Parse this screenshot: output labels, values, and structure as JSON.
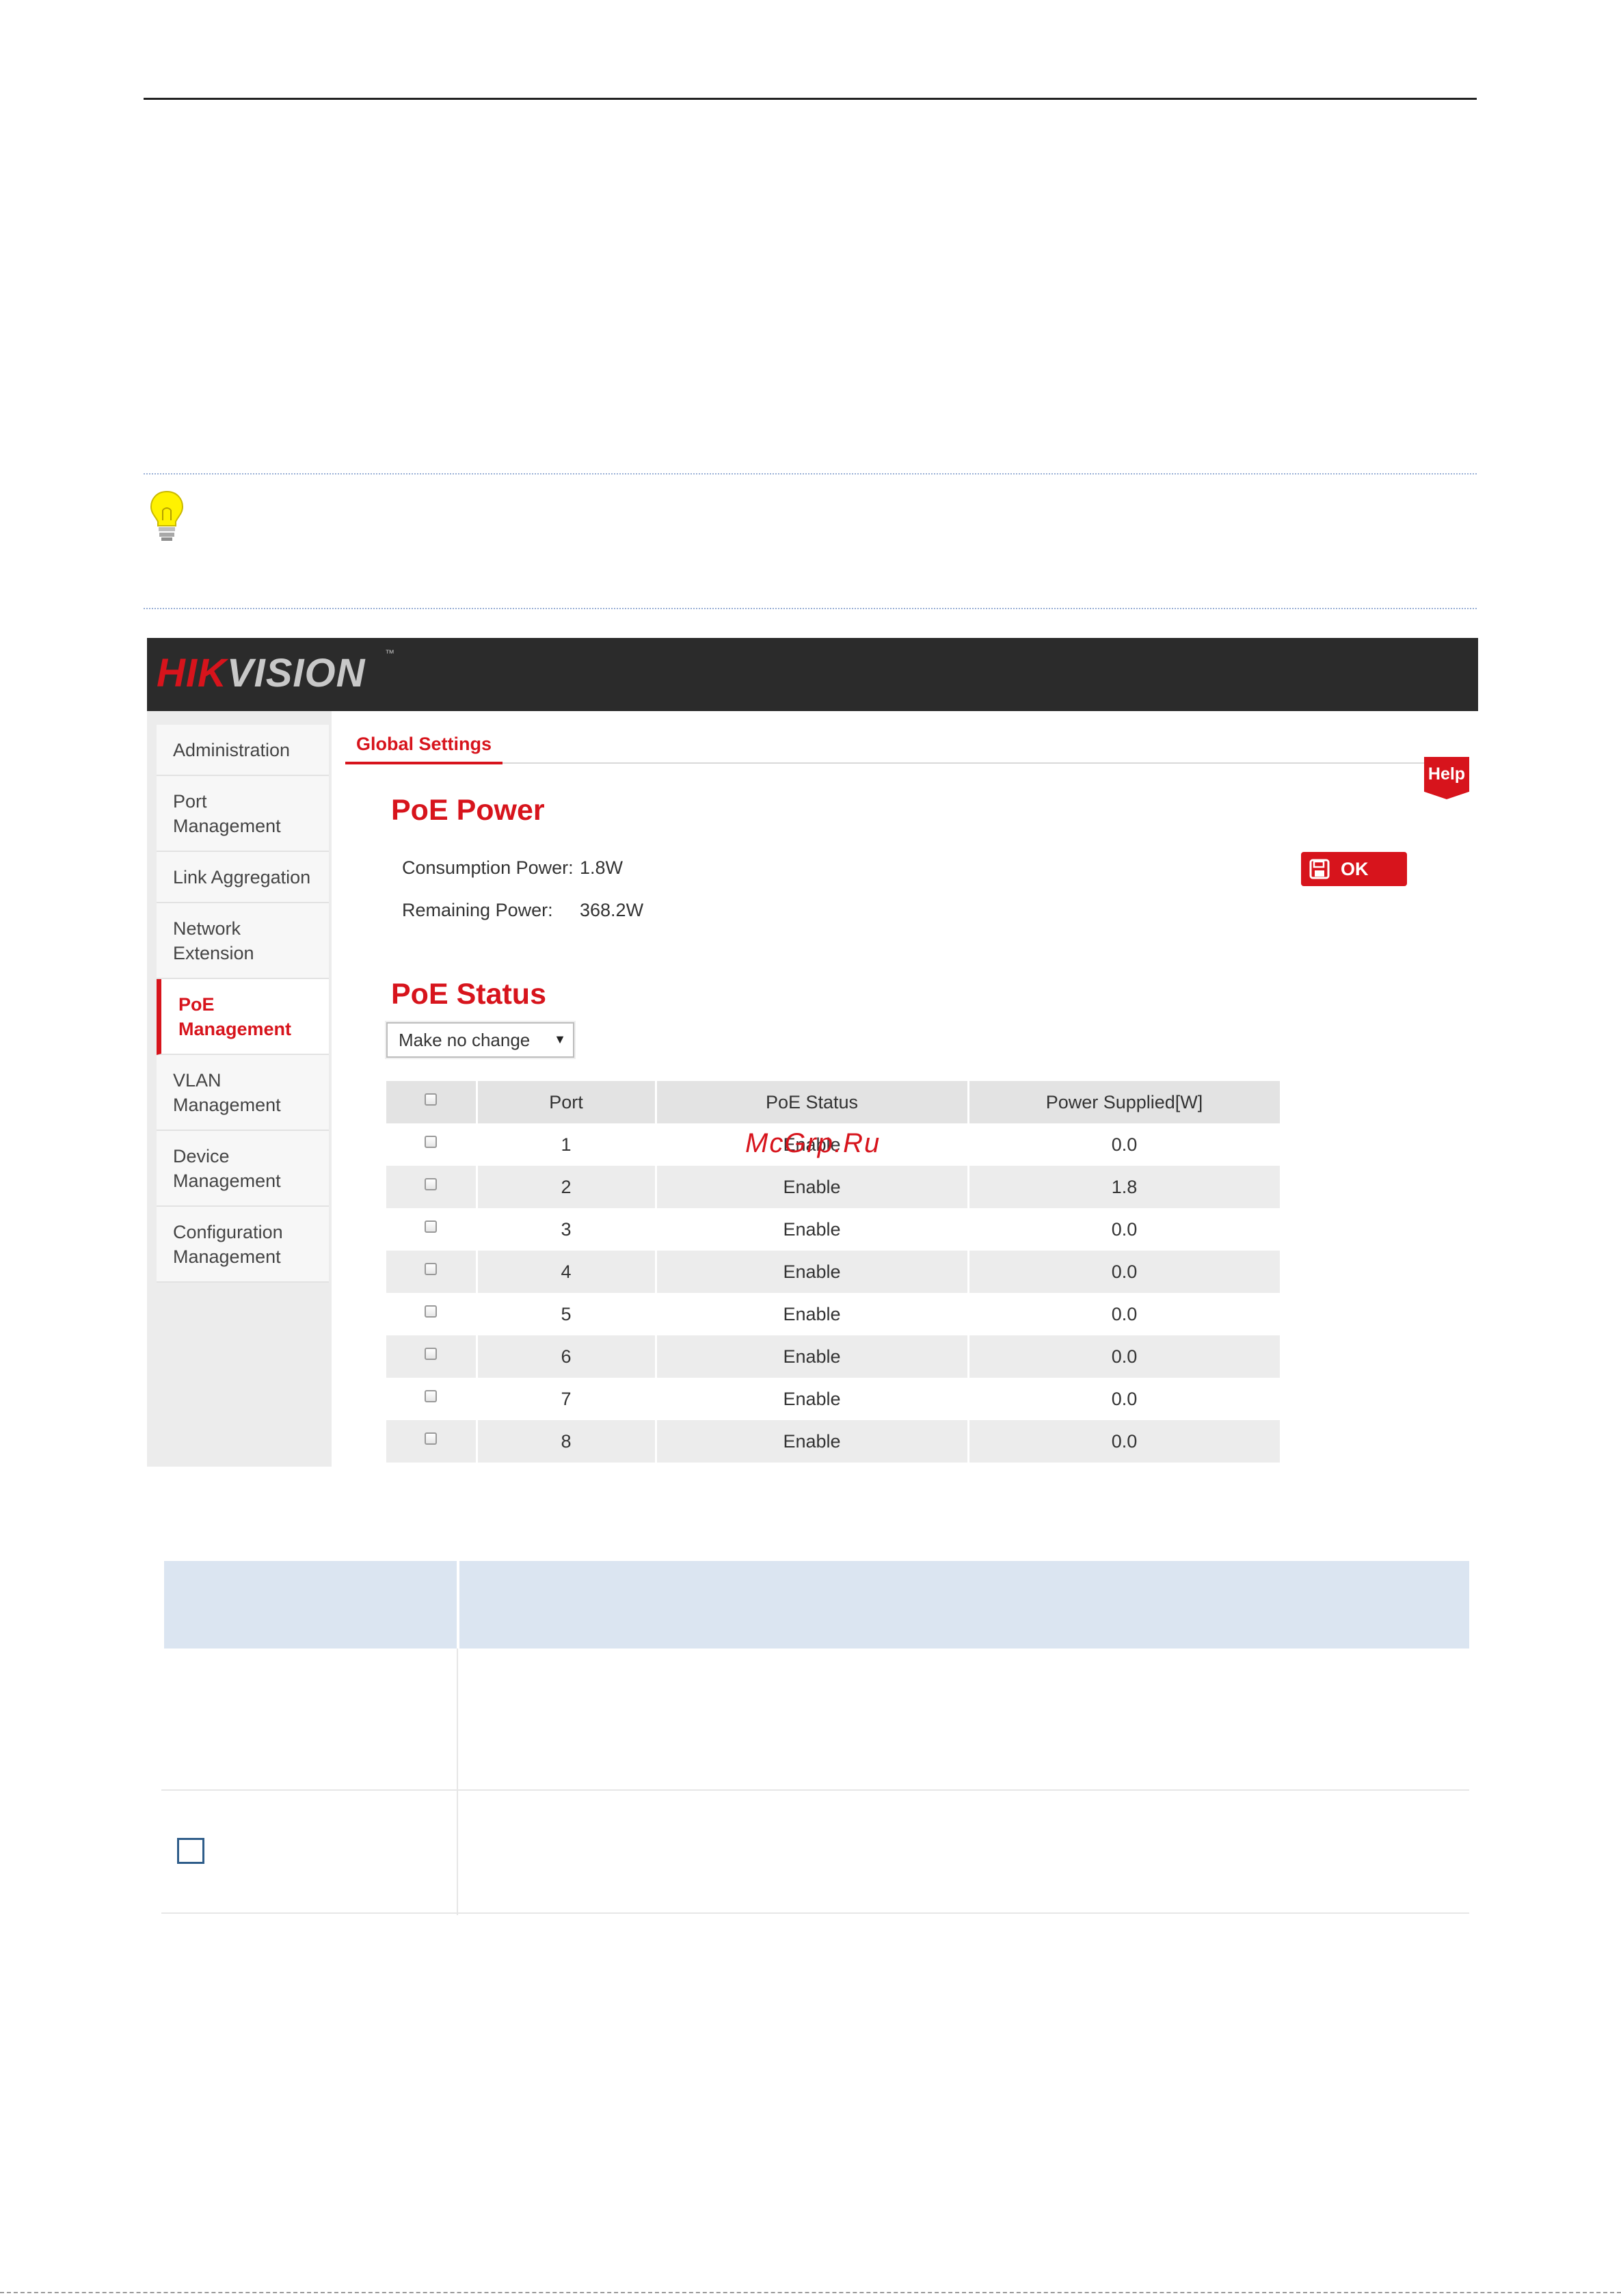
{
  "app": {
    "brand_hik": "HIK",
    "brand_vision": "VISION",
    "brand_tm": "™"
  },
  "sidebar": {
    "items": [
      {
        "label": "Administration"
      },
      {
        "label": "Port\nManagement"
      },
      {
        "label": "Link Aggregation"
      },
      {
        "label": "Network\nExtension"
      },
      {
        "label": "PoE\nManagement",
        "active": true
      },
      {
        "label": "VLAN\nManagement"
      },
      {
        "label": "Device\nManagement"
      },
      {
        "label": "Configuration\nManagement"
      }
    ]
  },
  "tabs": {
    "active_label": "Global Settings",
    "help_label": "Help"
  },
  "poe_power": {
    "title": "PoE Power",
    "consumption_label": "Consumption Power:",
    "consumption_value": "1.8W",
    "remaining_label": "Remaining Power:",
    "remaining_value": "368.2W",
    "ok_label": "OK"
  },
  "poe_status": {
    "title": "PoE Status",
    "select_value": "Make no change",
    "columns": [
      "Port",
      "PoE Status",
      "Power Supplied[W]"
    ],
    "rows": [
      {
        "port": "1",
        "status": "Enable",
        "power": "0.0"
      },
      {
        "port": "2",
        "status": "Enable",
        "power": "1.8"
      },
      {
        "port": "3",
        "status": "Enable",
        "power": "0.0"
      },
      {
        "port": "4",
        "status": "Enable",
        "power": "0.0"
      },
      {
        "port": "5",
        "status": "Enable",
        "power": "0.0"
      },
      {
        "port": "6",
        "status": "Enable",
        "power": "0.0"
      },
      {
        "port": "7",
        "status": "Enable",
        "power": "0.0"
      },
      {
        "port": "8",
        "status": "Enable",
        "power": "0.0"
      }
    ]
  },
  "watermark": "McGrp.Ru",
  "colors": {
    "accent": "#d7141c",
    "header_bg": "#2b2b2b",
    "table_head": "#dbe5f1"
  }
}
